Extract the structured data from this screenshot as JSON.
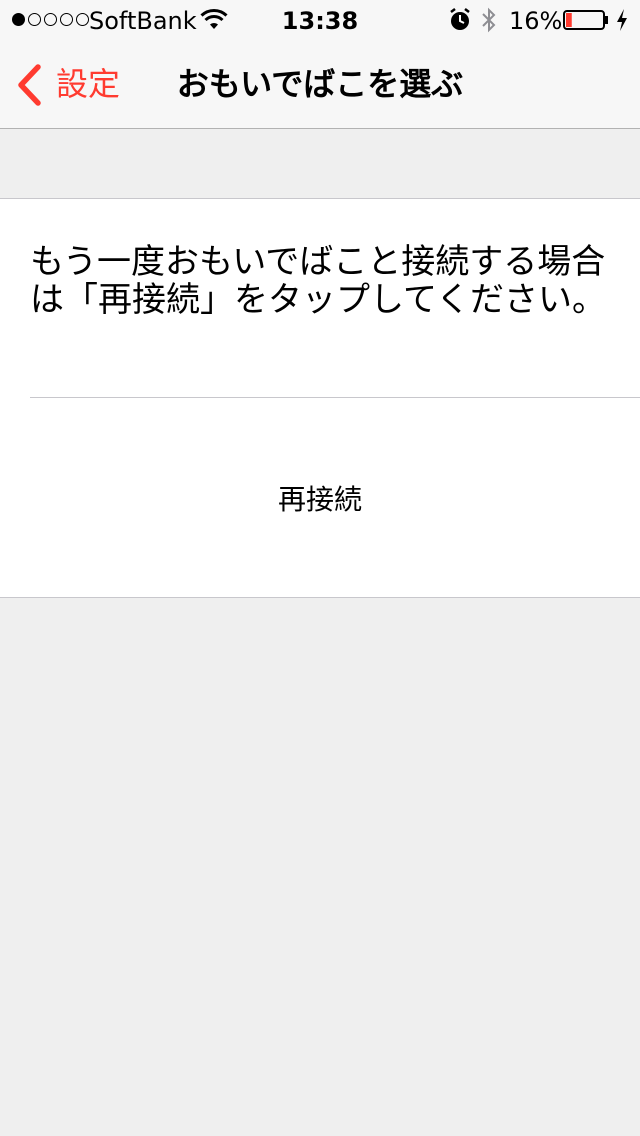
{
  "status_bar": {
    "signal_filled": 1,
    "signal_total": 5,
    "carrier": "SoftBank",
    "time": "13:38",
    "battery_percent_label": "16%",
    "battery_level": 0.16,
    "battery_color": "#ff3b30",
    "icons": [
      "wifi-icon",
      "alarm-icon",
      "bluetooth-icon",
      "battery-icon",
      "charging-icon"
    ]
  },
  "nav": {
    "back_label": "設定",
    "title": "おもいでばこを選ぶ",
    "accent_color": "#ff3b30"
  },
  "card": {
    "message": "もう一度おもいでばこと接続する場合は「再接続」をタップしてください。",
    "reconnect_label": "再接続"
  }
}
